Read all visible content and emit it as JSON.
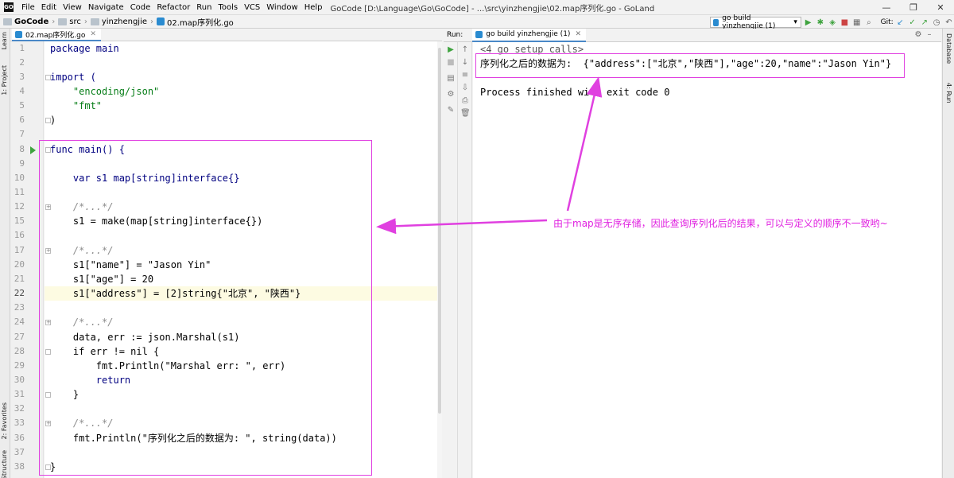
{
  "window": {
    "title": "GoCode [D:\\Language\\Go\\GoCode] - ...\\src\\yinzhengjie\\02.map序列化.go - GoLand",
    "logo": "GO",
    "controls": [
      "—",
      "❐",
      "✕"
    ]
  },
  "menu": [
    "File",
    "Edit",
    "View",
    "Navigate",
    "Code",
    "Refactor",
    "Run",
    "Tools",
    "VCS",
    "Window",
    "Help"
  ],
  "breadcrumb": [
    "GoCode",
    "src",
    "yinzhengjie",
    "02.map序列化.go"
  ],
  "toolbar": {
    "run_config": "go build yinzhengjie (1)",
    "git_label": "Git:"
  },
  "left_tool_tabs": [
    "1: Project",
    "Learn",
    "2: Favorites",
    "Structure"
  ],
  "right_tool_tabs": [
    "Database",
    "4: Run"
  ],
  "editor": {
    "tab_label": "02.map序列化.go",
    "line_numbers": [
      "1",
      "2",
      "3",
      "4",
      "5",
      "6",
      "7",
      "8",
      "9",
      "10",
      "11",
      "12",
      "15",
      "16",
      "17",
      "20",
      "21",
      "22",
      "23",
      "24",
      "27",
      "28",
      "29",
      "30",
      "31",
      "32",
      "33",
      "36",
      "37",
      "38"
    ],
    "current_line": "22",
    "lines": [
      "package main",
      "",
      "import (",
      "    \"encoding/json\"",
      "    \"fmt\"",
      ")",
      "",
      "func main() {",
      "",
      "    var s1 map[string]interface{}",
      "",
      "    /*...*/",
      "    s1 = make(map[string]interface{})",
      "",
      "    /*...*/",
      "    s1[\"name\"] = \"Jason Yin\"",
      "    s1[\"age\"] = 20",
      "    s1[\"address\"] = [2]string{\"北京\", \"陕西\"}",
      "",
      "    /*...*/",
      "    data, err := json.Marshal(s1)",
      "    if err != nil {",
      "        fmt.Println(\"Marshal err: \", err)",
      "        return",
      "    }",
      "",
      "    /*...*/",
      "    fmt.Println(\"序列化之后的数据为: \", string(data))",
      "",
      "}"
    ]
  },
  "run_panel": {
    "label": "Run:",
    "tab_label": "go build yinzhengjie (1)",
    "console": [
      "<4 go setup calls>",
      "序列化之后的数据为:  {\"address\":[\"北京\",\"陕西\"],\"age\":20,\"name\":\"Jason Yin\"}",
      "",
      "Process finished with exit code 0"
    ]
  },
  "annotation": {
    "text": "由于map是无序存储，因此查询序列化后的结果，可以与定义的顺序不一致哟~",
    "color": "#e040e0"
  }
}
